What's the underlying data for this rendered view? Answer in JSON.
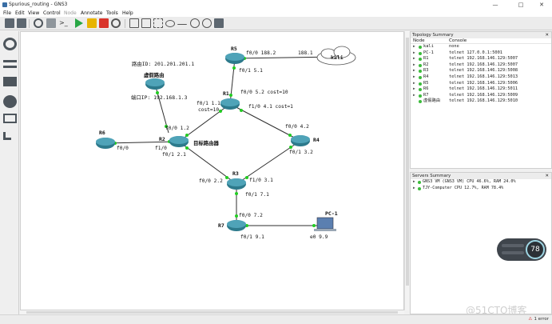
{
  "window": {
    "title": "Spurious_routing - GNS3"
  },
  "menu": [
    "File",
    "Edit",
    "View",
    "Control",
    "Node",
    "Annotate",
    "Tools",
    "Help"
  ],
  "canvas": {
    "notes": {
      "router_id": "路由ID: 201.201.201.1",
      "virtual_router": "虚假路由",
      "port_ip": "端口IP: 192.168.1.3",
      "target_router": "目标路由器"
    },
    "nodes": {
      "r5": "R5",
      "r1": "R1",
      "r6": "R6",
      "r2": "R2",
      "r4": "R4",
      "r3": "R3",
      "r7": "R7",
      "pc1": "PC-1",
      "kali": "kali"
    },
    "ports": {
      "r5_f00": "f0/0 188.2",
      "kali_e": "188.1",
      "r5_f01": "f0/1 5.1",
      "r1_f00": "f0/0 5.2 cost=10",
      "r1_f01": "f0/1 1.1",
      "r1_cost": "cost=10",
      "r1_f10": "f1/0 4.1 cost=1",
      "r2_f00": "f0/0 1.2",
      "r2_f10": "f1/0",
      "r2_f01": "f0/1 2.1",
      "r6_f00": "f0/0",
      "r4_f00": "f0/0 4.2",
      "r4_f01": "f0/1 3.2",
      "r3_f00": "f0/0 2.2",
      "r3_f10": "f1/0 3.1",
      "r3_f01": "f0/1 7.1",
      "r7_f00": "f0/0 7.2",
      "r7_f01": "f0/1 9.1",
      "pc1_e0": "e0 9.9"
    }
  },
  "topology_summary": {
    "title": "Topology Summary",
    "col_node": "Node",
    "col_console": "Console",
    "rows": [
      {
        "node": "kali",
        "console": "none"
      },
      {
        "node": "PC-1",
        "console": "telnet 127.0.0.1:5001"
      },
      {
        "node": "R1",
        "console": "telnet 192.168.146.129:5007"
      },
      {
        "node": "R2",
        "console": "telnet 192.168.146.129:5007"
      },
      {
        "node": "R3",
        "console": "telnet 192.168.146.129:5008"
      },
      {
        "node": "R4",
        "console": "telnet 192.168.146.129:5013"
      },
      {
        "node": "R5",
        "console": "telnet 192.168.146.129:5006"
      },
      {
        "node": "R6",
        "console": "telnet 192.168.146.129:5011"
      },
      {
        "node": "R7",
        "console": "telnet 192.168.146.129:5009"
      },
      {
        "node": "虚假路由",
        "console": "telnet 192.168.146.129:5010"
      }
    ]
  },
  "servers_summary": {
    "title": "Servers Summary",
    "rows": [
      "GNS3 VM (GNS3 VM) CPU 46.6%, RAM 24.0%",
      "TJY-Computer CPU 12.7%, RAM 78.4%"
    ]
  },
  "gauge": {
    "value": "78"
  },
  "watermark": "@51CTO博客",
  "status": {
    "errors": "1 error"
  },
  "colors": {
    "link": "#2e2e2e",
    "link_dot": "#22cc22",
    "router": "#2d7a8c",
    "status_green": "#3cbb3c"
  }
}
